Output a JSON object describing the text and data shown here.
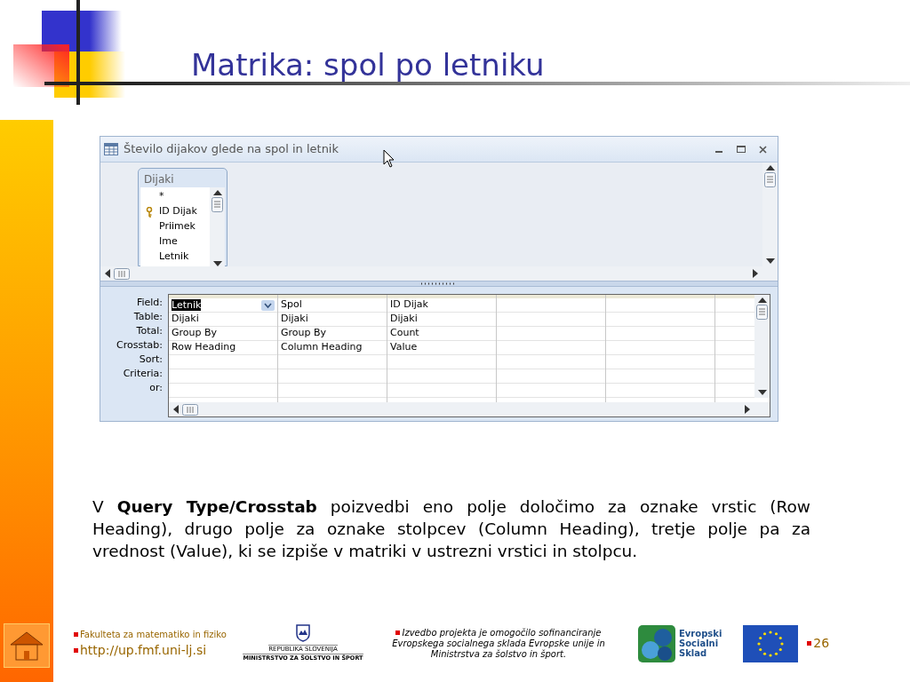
{
  "slide": {
    "title": "Matrika: spol po letniku",
    "page_number": "26"
  },
  "window": {
    "title": "Število dijakov glede na spol in letnik"
  },
  "table_box": {
    "title": "Dijaki",
    "fields": [
      {
        "name": "*",
        "key": false
      },
      {
        "name": "ID Dijak",
        "key": true
      },
      {
        "name": "Priimek",
        "key": false
      },
      {
        "name": "Ime",
        "key": false
      },
      {
        "name": "Letnik",
        "key": false
      }
    ]
  },
  "grid": {
    "row_labels": [
      "Field:",
      "Table:",
      "Total:",
      "Crosstab:",
      "Sort:",
      "Criteria:",
      "or:"
    ],
    "columns": [
      {
        "cells": [
          "Letnik",
          "Dijaki",
          "Group By",
          "Row Heading"
        ],
        "selected": true
      },
      {
        "cells": [
          "Spol",
          "Dijaki",
          "Group By",
          "Column Heading"
        ],
        "selected": false
      },
      {
        "cells": [
          "ID Dijak",
          "Dijaki",
          "Count",
          "Value"
        ],
        "selected": false
      }
    ]
  },
  "paragraph": "V **Query Type/Crosstab** poizvedbi eno polje določimo za oznake vrstic (Row Heading), drugo polje za oznake stolpcev (Column Heading), tretje polje pa za vrednost (Value), ki se izpiše v matriki v ustrezni vrstici in stolpcu.",
  "footer": {
    "faculty": "Fakulteta za matematiko in fiziko",
    "url": "http://up.fmf.uni-lj.si",
    "ministry_lines": [
      "REPUBLIKA SLOVENIJA",
      "MINISTRSTVO ZA ŠOLSTVO IN ŠPORT"
    ],
    "note": "Izvedbo projekta je omogočilo sofinanciranje Evropskega socialnega sklada Evropske unije in Ministrstva za šolstvo in šport.",
    "fund_lines": [
      "Evropski",
      "Socialni",
      "Sklad"
    ]
  }
}
